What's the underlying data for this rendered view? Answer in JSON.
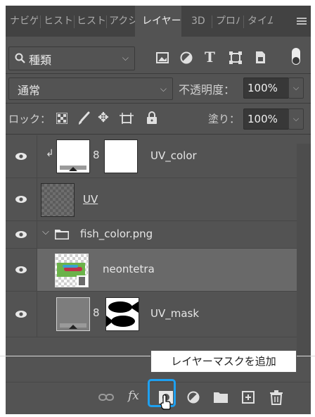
{
  "tabs": [
    {
      "label": "ナビゲ"
    },
    {
      "label": "ヒスト"
    },
    {
      "label": "ヒスト"
    },
    {
      "label": "アクシ"
    },
    {
      "label": "レイヤー",
      "active": true
    },
    {
      "label": "3D"
    },
    {
      "label": "プロパ"
    },
    {
      "label": "タイム"
    }
  ],
  "filter": {
    "label": "種類",
    "icons": [
      "image-filter-icon",
      "adjustment-filter-icon",
      "type-filter-icon",
      "shape-filter-icon",
      "smart-object-filter-icon",
      "filter-toggle-icon"
    ]
  },
  "blend": {
    "mode": "通常",
    "opacity_label": "不透明度：",
    "opacity_value": "100%"
  },
  "lock": {
    "label": "ロック：",
    "fill_label": "塗り：",
    "fill_value": "100%"
  },
  "layers": [
    {
      "name": "UV_color",
      "type": "clipped-adjustment-with-mask"
    },
    {
      "name": "UV",
      "type": "pixel"
    },
    {
      "name": "fish_color.png",
      "type": "group"
    },
    {
      "name": "neontetra",
      "type": "smart-object",
      "selected": true
    },
    {
      "name": "UV_mask",
      "type": "adjustment-with-mask"
    }
  ],
  "tooltip": "レイヤーマスクを追加",
  "bottom_icons": [
    "link-layers-icon",
    "fx-icon",
    "add-mask-icon",
    "adjustment-layer-icon",
    "new-group-icon",
    "new-layer-icon",
    "delete-icon"
  ],
  "colors": {
    "highlight": "#1ea0f0",
    "panel": "#535353",
    "selected_layer": "#696969"
  }
}
